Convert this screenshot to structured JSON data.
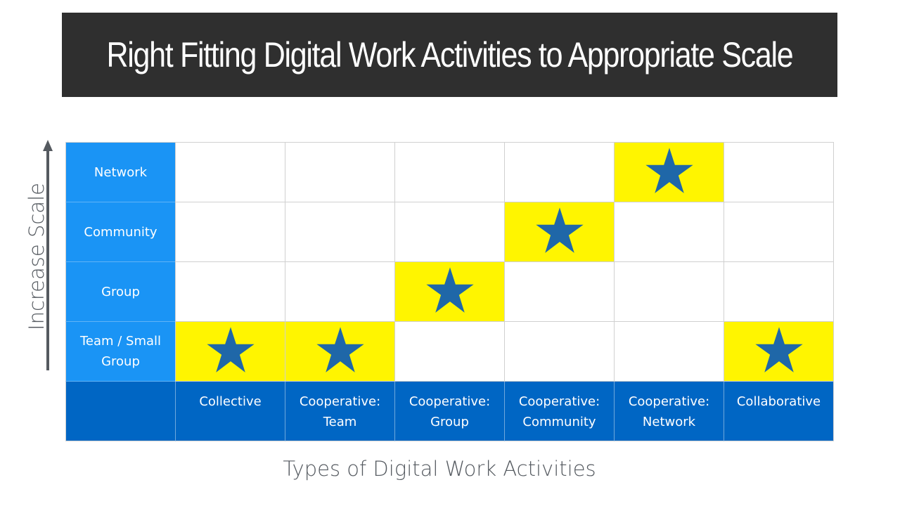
{
  "title": "Right Fitting Digital Work Activities to Appropriate Scale",
  "y_axis_label": "Increase Scale",
  "x_axis_label": "Types of Digital Work Activities",
  "colors": {
    "title_background": "#2f2f2f",
    "row_header": "#1a94f5",
    "column_header": "#0066c4",
    "highlight": "#fff500",
    "star": "#1f67a8",
    "axis_text": "#555a60"
  },
  "rows": [
    "Network",
    "Community",
    "Group",
    "Team / Small Group"
  ],
  "columns": [
    "Collective",
    "Cooperative: Team",
    "Cooperative: Group",
    "Cooperative: Community",
    "Cooperative: Network",
    "Collaborative"
  ],
  "matrix": [
    [
      false,
      false,
      false,
      false,
      true,
      false
    ],
    [
      false,
      false,
      false,
      true,
      false,
      false
    ],
    [
      false,
      false,
      true,
      false,
      false,
      false
    ],
    [
      true,
      true,
      false,
      false,
      false,
      true
    ]
  ],
  "marker_icon": "star-icon"
}
